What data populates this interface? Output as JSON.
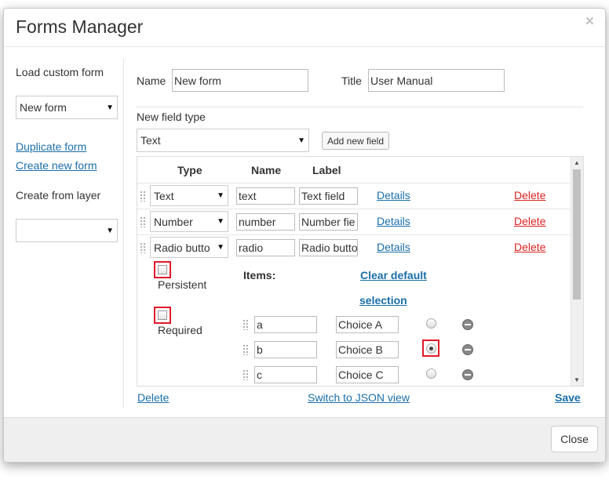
{
  "dialog": {
    "title": "Forms Manager",
    "close_x": "×",
    "close_button": "Close"
  },
  "left": {
    "load_label": "Load custom form",
    "load_select": "New form",
    "duplicate_link": "Duplicate form",
    "create_link": "Create new form",
    "from_layer_label": "Create from layer",
    "layer_select": ""
  },
  "form": {
    "name_label": "Name",
    "name_value": "New form",
    "title_label": "Title",
    "title_value": "User Manual",
    "new_field_label": "New field type",
    "new_field_select": "Text",
    "add_button": "Add new field"
  },
  "table": {
    "headers": {
      "type": "Type",
      "name": "Name",
      "label": "Label"
    },
    "rows": [
      {
        "type": "Text",
        "name": "text",
        "label": "Text field",
        "details": "Details",
        "delete": "Delete"
      },
      {
        "type": "Number",
        "name": "number",
        "label": "Number fie",
        "details": "Details",
        "delete": "Delete"
      },
      {
        "type": "Radio butto",
        "name": "radio",
        "label": "Radio butto",
        "details": "Details",
        "delete": "Delete"
      }
    ],
    "persistent_label": "Persistent",
    "required_label": "Required",
    "items_label": "Items:",
    "clear_default_1": "Clear default",
    "clear_default_2": "selection",
    "items": [
      {
        "value": "a",
        "label": "Choice A",
        "selected": false
      },
      {
        "value": "b",
        "label": "Choice B",
        "selected": true
      },
      {
        "value": "c",
        "label": "Choice C",
        "selected": false
      }
    ]
  },
  "bottom": {
    "delete": "Delete",
    "json_view": "Switch to JSON view",
    "save": "Save"
  },
  "colors": {
    "link": "#1a6ea8",
    "delete": "#dd2222",
    "highlight": "#e0192a"
  }
}
